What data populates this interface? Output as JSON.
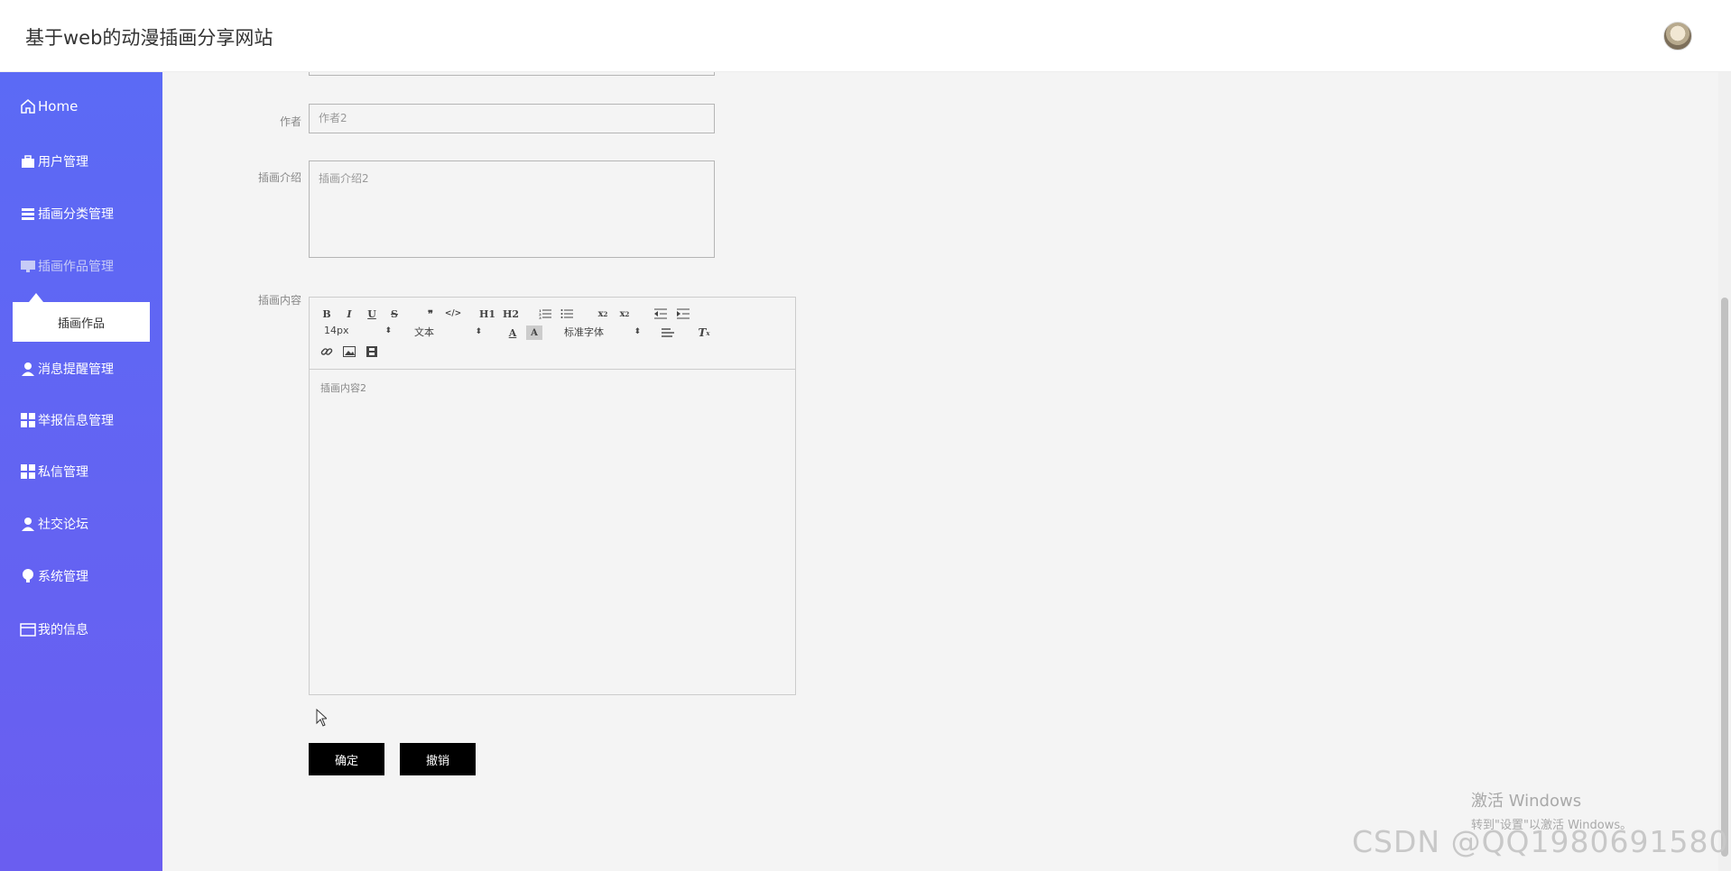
{
  "header": {
    "title": "基于web的动漫插画分享网站"
  },
  "sidebar": {
    "items": [
      {
        "label": "Home",
        "icon": "home-icon"
      },
      {
        "label": "用户管理",
        "icon": "briefcase-icon"
      },
      {
        "label": "插画分类管理",
        "icon": "list-icon"
      },
      {
        "label": "插画作品管理",
        "icon": "monitor-icon"
      },
      {
        "label": "消息提醒管理",
        "icon": "user-icon"
      },
      {
        "label": "举报信息管理",
        "icon": "grid-icon"
      },
      {
        "label": "私信管理",
        "icon": "grid-icon"
      },
      {
        "label": "社交论坛",
        "icon": "user-icon"
      },
      {
        "label": "系统管理",
        "icon": "bulb-icon"
      },
      {
        "label": "我的信息",
        "icon": "card-icon"
      }
    ],
    "submenu_label": "插画作品"
  },
  "form": {
    "author_label": "作者",
    "author_placeholder": "作者2",
    "intro_label": "插画介绍",
    "intro_placeholder": "插画介绍2",
    "content_label": "插画内容",
    "content_value": "插画内容2"
  },
  "editor": {
    "font_size": "14px",
    "text_style": "文本",
    "font_family": "标准字体",
    "h1": "H1",
    "h2": "H2"
  },
  "buttons": {
    "confirm": "确定",
    "cancel": "撤销"
  },
  "watermark": {
    "windows_line1": "激活 Windows",
    "windows_line2": "转到\"设置\"以激活 Windows。",
    "csdn": "CSDN @QQ1980691580"
  }
}
